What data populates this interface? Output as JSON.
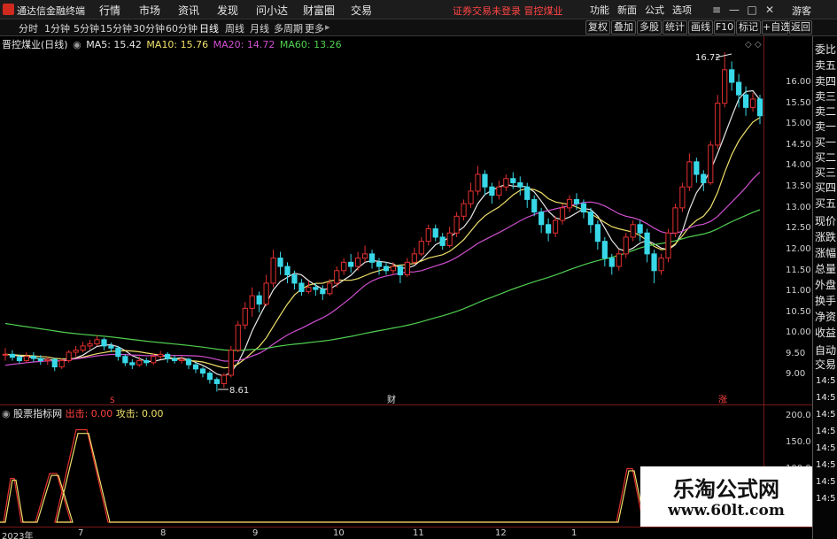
{
  "app": {
    "title": "通达信金融终端"
  },
  "menu": [
    "行情",
    "市场",
    "资讯",
    "发现",
    "问小达",
    "财富圈",
    "交易"
  ],
  "notice": "证券交易未登录   冒控煤业",
  "topbar_right": [
    "功能",
    "新面",
    "公式",
    "选项"
  ],
  "guest_label": "游客",
  "periods": [
    "分时",
    "1分钟",
    "5分钟",
    "15分钟",
    "30分钟",
    "60分钟",
    "日线",
    "周线",
    "月线",
    "多周期",
    "更多"
  ],
  "active_period": "日线",
  "toolbar_right": [
    "复权",
    "叠加",
    "多股",
    "统计",
    "画线",
    "F10",
    "标记",
    "+自选",
    "返回"
  ],
  "stock": {
    "name": "晋控煤业(日线)"
  },
  "ma_legend": [
    {
      "label": "MA5: 15.42",
      "color": "#e8e8e8"
    },
    {
      "label": "MA10: 15.76",
      "color": "#f0e06a"
    },
    {
      "label": "MA20: 14.72",
      "color": "#d050d0"
    },
    {
      "label": "MA60: 13.26",
      "color": "#50d050"
    }
  ],
  "colors": {
    "up": "#e43030",
    "down": "#38d8e8",
    "ma5": "#e8e8e8",
    "ma10": "#f0e06a",
    "ma20": "#d050d0",
    "ma60": "#50d050",
    "grid_border": "#7a1a1a"
  },
  "main_axis": [
    "16.00",
    "15.50",
    "15.00",
    "14.50",
    "14.00",
    "13.50",
    "13.00",
    "12.50",
    "12.00",
    "11.50",
    "11.00",
    "10.50",
    "10.00",
    "9.50",
    "9.00"
  ],
  "annotations": {
    "high": "16.72",
    "low": "8.61",
    "marker_left": "S",
    "marker_mid": "财",
    "marker_right": "涨"
  },
  "indicator": {
    "name": "股票指标网",
    "out_label": "出击: 0.00",
    "attack_label": "攻击: 0.00",
    "axis": [
      "200.0",
      "150.0",
      "100.0"
    ]
  },
  "x_axis": [
    "2023年",
    "7",
    "8",
    "9",
    "10",
    "11",
    "12",
    "1"
  ],
  "side_panel": [
    "委比",
    "卖五",
    "卖四",
    "卖三",
    "卖二",
    "卖一",
    "买一",
    "买二",
    "买三",
    "买四",
    "买五",
    "现价",
    "涨跌",
    "涨幅",
    "总量",
    "外盘",
    "换手",
    "净资",
    "收益",
    "自动",
    "交易"
  ],
  "side_times": [
    "14:5",
    "14:5",
    "14:5",
    "14:5",
    "14:5",
    "14:5",
    "14:5",
    "14:5"
  ],
  "watermark": {
    "title": "乐淘公式网",
    "url": "www.60lt.com"
  },
  "chart_data": {
    "type": "candlestick",
    "title": "晋控煤业(日线)",
    "ylim": [
      8.6,
      16.75
    ],
    "ma_values": {
      "MA5": 15.42,
      "MA10": 15.76,
      "MA20": 14.72,
      "MA60": 13.26
    },
    "candles": [
      [
        9.5,
        9.5,
        9.65,
        9.35
      ],
      [
        9.5,
        9.43,
        9.6,
        9.35
      ],
      [
        9.43,
        9.35,
        9.5,
        9.28
      ],
      [
        9.35,
        9.45,
        9.55,
        9.3
      ],
      [
        9.45,
        9.4,
        9.55,
        9.32
      ],
      [
        9.4,
        9.35,
        9.48,
        9.25
      ],
      [
        9.35,
        9.38,
        9.45,
        9.25
      ],
      [
        9.38,
        9.2,
        9.42,
        9.1
      ],
      [
        9.2,
        9.35,
        9.4,
        9.15
      ],
      [
        9.35,
        9.55,
        9.6,
        9.3
      ],
      [
        9.55,
        9.6,
        9.7,
        9.45
      ],
      [
        9.6,
        9.7,
        9.8,
        9.55
      ],
      [
        9.7,
        9.75,
        9.85,
        9.62
      ],
      [
        9.75,
        9.85,
        9.95,
        9.7
      ],
      [
        9.85,
        9.7,
        9.9,
        9.6
      ],
      [
        9.7,
        9.65,
        9.78,
        9.55
      ],
      [
        9.65,
        9.45,
        9.7,
        9.35
      ],
      [
        9.45,
        9.3,
        9.5,
        9.22
      ],
      [
        9.3,
        9.25,
        9.38,
        9.15
      ],
      [
        9.25,
        9.35,
        9.45,
        9.2
      ],
      [
        9.35,
        9.3,
        9.42,
        9.22
      ],
      [
        9.3,
        9.45,
        9.52,
        9.25
      ],
      [
        9.45,
        9.5,
        9.58,
        9.38
      ],
      [
        9.5,
        9.4,
        9.55,
        9.3
      ],
      [
        9.4,
        9.35,
        9.48,
        9.28
      ],
      [
        9.35,
        9.38,
        9.45,
        9.28
      ],
      [
        9.38,
        9.25,
        9.42,
        9.15
      ],
      [
        9.25,
        9.15,
        9.3,
        9.05
      ],
      [
        9.15,
        9.05,
        9.2,
        8.95
      ],
      [
        9.05,
        8.9,
        9.1,
        8.8
      ],
      [
        8.9,
        8.8,
        8.95,
        8.61
      ],
      [
        8.8,
        9.0,
        9.05,
        8.7
      ],
      [
        9.0,
        9.6,
        9.7,
        8.95
      ],
      [
        9.6,
        10.2,
        10.3,
        9.55
      ],
      [
        10.2,
        10.6,
        10.75,
        10.1
      ],
      [
        10.6,
        10.9,
        11.1,
        10.4
      ],
      [
        10.9,
        10.7,
        11.0,
        10.5
      ],
      [
        10.7,
        11.2,
        11.4,
        10.65
      ],
      [
        11.2,
        11.8,
        12.0,
        11.1
      ],
      [
        11.8,
        11.6,
        11.95,
        11.4
      ],
      [
        11.6,
        11.4,
        11.7,
        11.2
      ],
      [
        11.4,
        11.2,
        11.5,
        11.05
      ],
      [
        11.2,
        11.0,
        11.3,
        10.9
      ],
      [
        11.0,
        11.1,
        11.25,
        10.95
      ],
      [
        11.1,
        11.05,
        11.2,
        10.9
      ],
      [
        11.05,
        10.95,
        11.15,
        10.8
      ],
      [
        10.95,
        11.2,
        11.3,
        10.9
      ],
      [
        11.2,
        11.5,
        11.6,
        11.1
      ],
      [
        11.5,
        11.7,
        11.8,
        11.4
      ],
      [
        11.7,
        11.6,
        11.9,
        11.45
      ],
      [
        11.6,
        11.8,
        11.95,
        11.5
      ],
      [
        11.8,
        11.9,
        12.1,
        11.7
      ],
      [
        11.9,
        11.7,
        12.0,
        11.55
      ],
      [
        11.7,
        11.6,
        11.8,
        11.4
      ],
      [
        11.6,
        11.5,
        11.7,
        11.4
      ],
      [
        11.5,
        11.6,
        11.7,
        11.4
      ],
      [
        11.6,
        11.4,
        11.65,
        11.2
      ],
      [
        11.4,
        11.7,
        11.8,
        11.35
      ],
      [
        11.7,
        11.9,
        12.05,
        11.65
      ],
      [
        11.9,
        12.2,
        12.3,
        11.85
      ],
      [
        12.2,
        12.5,
        12.6,
        12.1
      ],
      [
        12.5,
        12.3,
        12.6,
        12.2
      ],
      [
        12.3,
        12.1,
        12.4,
        12.0
      ],
      [
        12.1,
        12.4,
        12.55,
        12.05
      ],
      [
        12.4,
        12.8,
        12.9,
        12.3
      ],
      [
        12.8,
        13.1,
        13.2,
        12.7
      ],
      [
        13.1,
        13.4,
        13.6,
        13.0
      ],
      [
        13.4,
        13.8,
        14.0,
        13.3
      ],
      [
        13.8,
        13.5,
        13.9,
        13.3
      ],
      [
        13.5,
        13.3,
        13.6,
        13.1
      ],
      [
        13.3,
        13.5,
        13.65,
        13.2
      ],
      [
        13.5,
        13.7,
        13.8,
        13.4
      ],
      [
        13.7,
        13.6,
        13.85,
        13.45
      ],
      [
        13.6,
        13.5,
        13.75,
        13.3
      ],
      [
        13.5,
        13.2,
        13.6,
        13.0
      ],
      [
        13.2,
        12.9,
        13.3,
        12.8
      ],
      [
        12.9,
        12.6,
        13.0,
        12.4
      ],
      [
        12.6,
        12.4,
        12.75,
        12.2
      ],
      [
        12.4,
        12.7,
        12.8,
        12.3
      ],
      [
        12.7,
        13.0,
        13.1,
        12.6
      ],
      [
        13.0,
        13.2,
        13.3,
        12.9
      ],
      [
        13.2,
        13.1,
        13.35,
        12.95
      ],
      [
        13.1,
        12.9,
        13.2,
        12.75
      ],
      [
        12.9,
        12.6,
        13.0,
        12.4
      ],
      [
        12.6,
        12.2,
        12.7,
        12.0
      ],
      [
        12.2,
        11.8,
        12.3,
        11.6
      ],
      [
        11.8,
        11.6,
        11.9,
        11.4
      ],
      [
        11.6,
        11.9,
        12.0,
        11.5
      ],
      [
        11.9,
        12.3,
        12.4,
        11.8
      ],
      [
        12.3,
        12.6,
        12.7,
        12.2
      ],
      [
        12.6,
        12.4,
        12.7,
        12.2
      ],
      [
        12.4,
        11.9,
        12.5,
        11.7
      ],
      [
        11.9,
        11.5,
        12.0,
        11.2
      ],
      [
        11.5,
        11.8,
        11.9,
        11.4
      ],
      [
        11.8,
        12.4,
        12.5,
        11.7
      ],
      [
        12.4,
        13.0,
        13.1,
        12.3
      ],
      [
        13.0,
        13.5,
        13.6,
        12.9
      ],
      [
        13.5,
        14.1,
        14.3,
        13.4
      ],
      [
        14.1,
        13.8,
        14.2,
        13.6
      ],
      [
        13.8,
        13.6,
        13.9,
        13.4
      ],
      [
        13.6,
        14.5,
        14.6,
        13.55
      ],
      [
        14.5,
        15.5,
        15.7,
        14.4
      ],
      [
        15.5,
        16.3,
        16.72,
        15.4
      ],
      [
        16.3,
        16.0,
        16.5,
        15.8
      ],
      [
        16.0,
        15.7,
        16.2,
        15.4
      ],
      [
        15.7,
        15.4,
        15.9,
        15.2
      ],
      [
        15.4,
        15.6,
        15.75,
        15.3
      ],
      [
        15.6,
        15.2,
        15.7,
        15.0
      ]
    ]
  }
}
